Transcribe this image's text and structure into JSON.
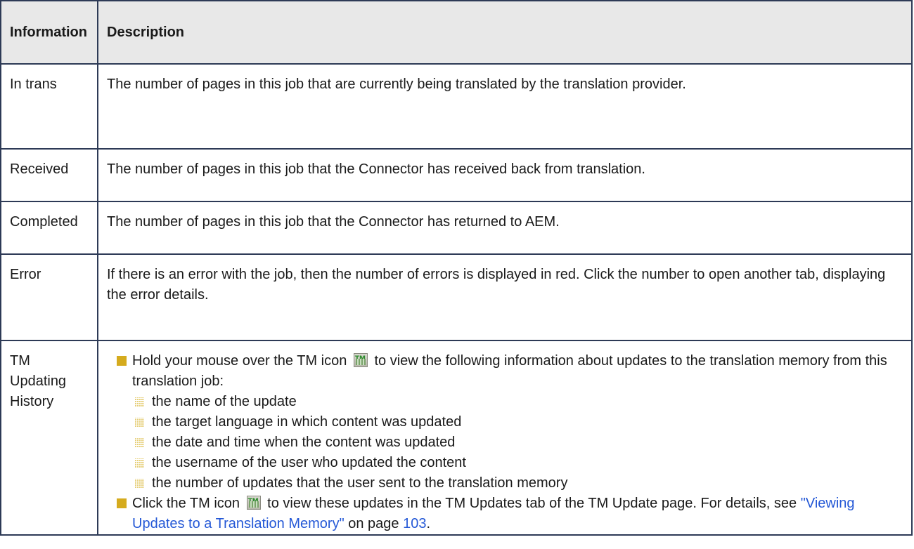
{
  "table": {
    "headers": [
      "Information",
      "Description"
    ],
    "rows": {
      "in_trans": {
        "label": "In trans",
        "description": "The number of pages in this job that are currently being translated by the translation provider."
      },
      "received": {
        "label": "Received",
        "description": "The number of pages in this job that the Connector has received back from translation."
      },
      "completed": {
        "label": "Completed",
        "description": "The number of pages in this job that the Connector has returned to AEM."
      },
      "error": {
        "label": "Error",
        "description": "If there is an error with the job, then the number of errors is displayed in red. Click the number to open another tab, displaying the error details."
      },
      "tm_history": {
        "label_lines": [
          "TM",
          "Updating",
          "History"
        ],
        "bullet1_before": "Hold your mouse over the TM icon",
        "bullet1_after": "to view the following information about updates to the translation memory from this translation job:",
        "sub_items": [
          "the name of the update",
          "the target language in which content was updated",
          "the date and time when the content was updated",
          "the username of the user who updated the content",
          "the number of updates that the user sent to the translation memory"
        ],
        "bullet2_before": "Click the TM icon",
        "bullet2_after": "to view these updates in the TM Updates tab of the TM Update page. For details, see",
        "link_text": "\"Viewing Updates to a Translation Memory\"",
        "page_prefix": "on page",
        "page_number": "103",
        "end_punct": "."
      }
    }
  },
  "colors": {
    "border": "#2d3a56",
    "header_bg": "#e8e8e8",
    "bullet": "#d5ab1e",
    "link": "#2458d6"
  },
  "icons": [
    "tm-icon",
    "square-bullet-icon",
    "grid-bullet-icon"
  ]
}
